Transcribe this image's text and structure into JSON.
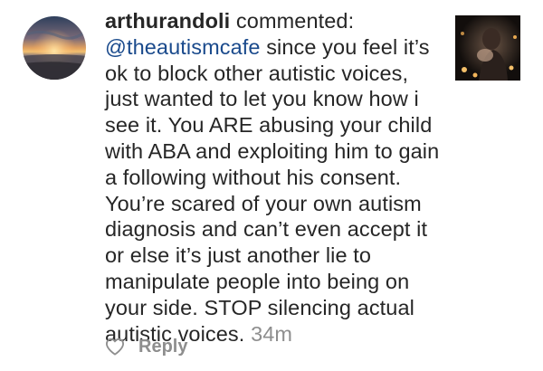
{
  "comment": {
    "username": "arthurandoli",
    "action_text": " commented:",
    "mention": "@theautismcafe",
    "body": " since you feel it’s ok to block other autistic voices, just wanted to let you know how i see it. You ARE abusing your child with ABA and exploiting him to gain a following without his consent. You’re scared of your own autism diagnosis and can’t even accept it or else it’s just another lie to manipulate people into being on your side. STOP silencing actual autistic voices.",
    "timestamp": "34m"
  },
  "actions": {
    "reply_label": "Reply"
  },
  "icons": {
    "like": "heart-outline-icon"
  },
  "colors": {
    "text": "#262626",
    "mention": "#1a4a8c",
    "muted": "#8e8e8e"
  }
}
